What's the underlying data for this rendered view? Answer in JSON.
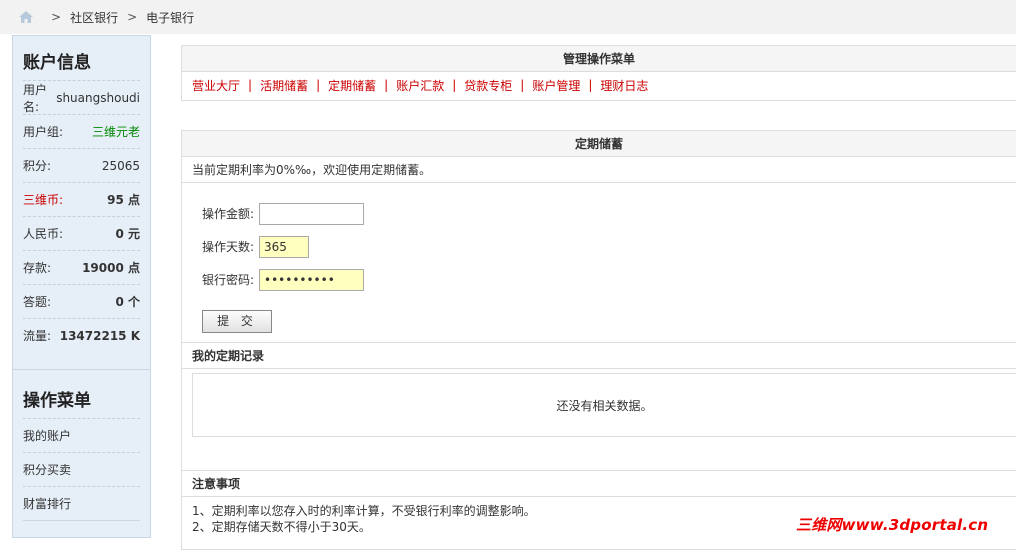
{
  "breadcrumb": {
    "items": [
      "社区银行",
      "电子银行"
    ],
    "sep": ">"
  },
  "account": {
    "title": "账户信息",
    "stats": [
      {
        "label": "用户名:",
        "value": "shuangshoudi"
      },
      {
        "label": "用户组:",
        "value": "三维元老"
      },
      {
        "label": "积分:",
        "value": "25065"
      },
      {
        "label": "三维币:",
        "value": "95 点"
      },
      {
        "label": "人民币:",
        "value": "0 元"
      },
      {
        "label": "存款:",
        "value": "19000 点"
      },
      {
        "label": "答题:",
        "value": "0 个"
      },
      {
        "label": "流量:",
        "value": "13472215 K"
      }
    ]
  },
  "ops_menu": {
    "title": "操作菜单",
    "items": [
      "我的账户",
      "积分买卖",
      "财富排行"
    ]
  },
  "admin": {
    "title": "管理操作菜单",
    "items": [
      "营业大厅",
      "活期储蓄",
      "定期储蓄",
      "账户汇款",
      "贷款专柜",
      "账户管理",
      "理财日志"
    ],
    "sep": "|"
  },
  "fixed": {
    "title": "定期储蓄",
    "notice": "当前定期利率为0%‰，欢迎使用定期储蓄。",
    "amount_label": "操作金额:",
    "amount_value": "",
    "days_label": "操作天数:",
    "days_value": "365",
    "password_label": "银行密码:",
    "password_value": "••••••••••",
    "submit": "提 交"
  },
  "records": {
    "title": "我的定期记录",
    "empty": "还没有相关数据。"
  },
  "notes": {
    "title": "注意事项",
    "items": [
      "1、定期利率以您存入时的利率计算，不受银行利率的调整影响。",
      "2、定期存储天数不得小于30天。"
    ]
  },
  "watermark": "三维网www.3dportal.cn",
  "colors": {
    "menu_red": "#cc0000",
    "group_green": "#008800",
    "input_yellow": "#ffffc0"
  }
}
